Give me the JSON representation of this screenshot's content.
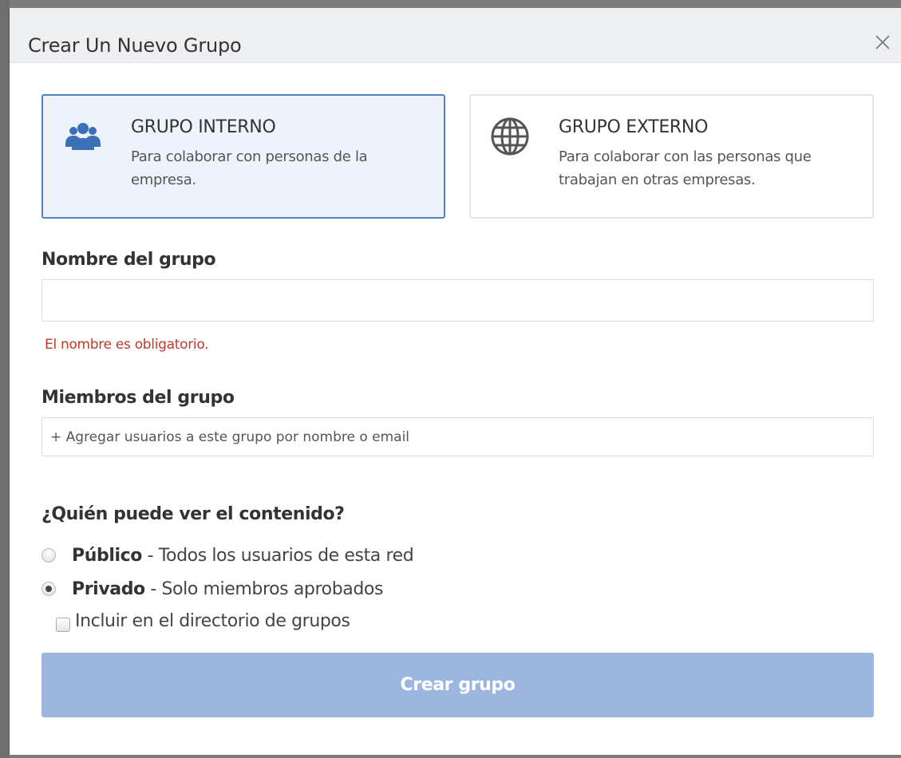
{
  "dialog": {
    "title": "Crear Un Nuevo Grupo",
    "close_icon": "close-icon"
  },
  "group_types": [
    {
      "title": "GRUPO INTERNO",
      "description": "Para colaborar con personas de la empresa.",
      "icon": "people-icon",
      "selected": true
    },
    {
      "title": "GRUPO EXTERNO",
      "description": "Para colaborar con las personas que trabajan en otras empresas.",
      "icon": "globe-icon",
      "selected": false
    }
  ],
  "name_field": {
    "label": "Nombre del grupo",
    "value": "",
    "placeholder": "",
    "error": "El nombre es obligatorio."
  },
  "members_field": {
    "label": "Miembros del grupo",
    "value": "",
    "placeholder": "+ Agregar usuarios a este grupo por nombre o email"
  },
  "visibility": {
    "label": "¿Quién puede ver el contenido?",
    "options": [
      {
        "name": "Público",
        "description": " - Todos los usuarios de esta red",
        "checked": false
      },
      {
        "name": "Privado",
        "description": " - Solo miembros aprobados",
        "checked": true
      }
    ],
    "directory_checkbox": {
      "label": "Incluir en el directorio de grupos",
      "checked": false
    }
  },
  "submit": {
    "label": "Crear grupo"
  },
  "colors": {
    "selected_border": "#4f81bd",
    "selected_bg": "#eef3fb",
    "error": "#c0392b",
    "button_disabled": "#9db6df",
    "icon_blue": "#3b6fb6"
  }
}
